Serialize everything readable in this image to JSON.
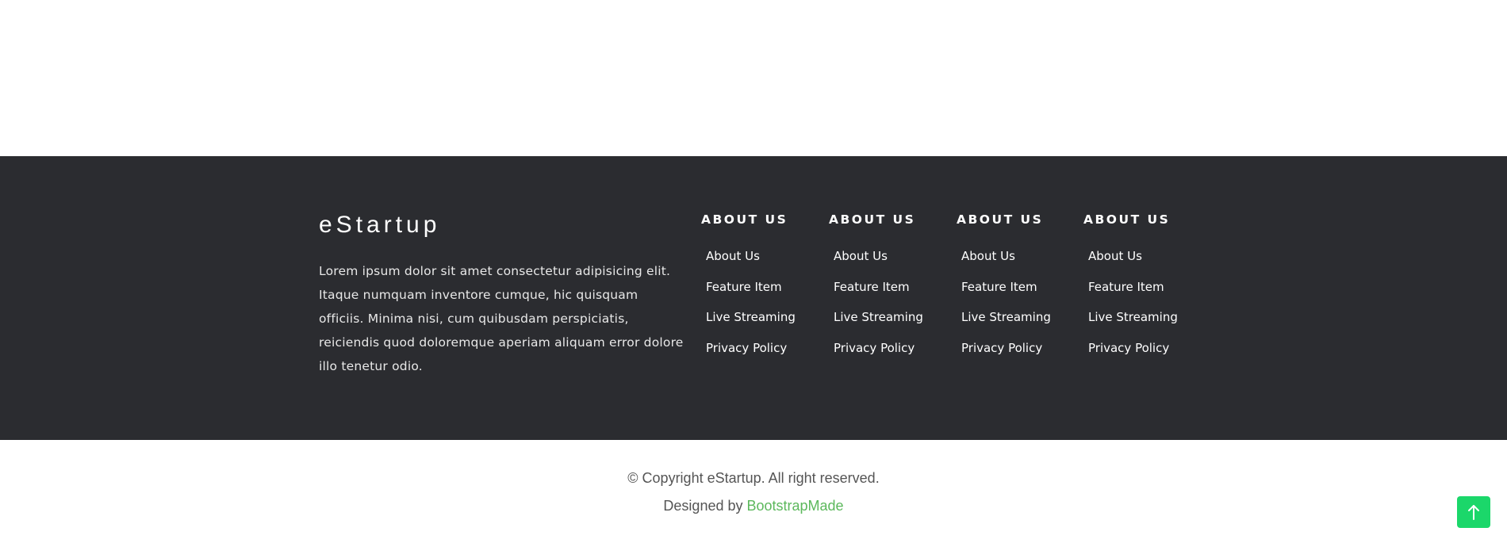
{
  "footer": {
    "brand": "eStartup",
    "description": "Lorem ipsum dolor sit amet consectetur adipisicing elit. Itaque numquam inventore cumque, hic quisquam officiis. Minima nisi, cum quibusdam perspiciatis, reiciendis quod doloremque aperiam aliquam error dolore illo tenetur odio.",
    "columns": [
      {
        "title": "ABOUT US",
        "links": [
          "About Us",
          "Feature Item",
          "Live Streaming",
          "Privacy Policy"
        ]
      },
      {
        "title": "ABOUT US",
        "links": [
          "About Us",
          "Feature Item",
          "Live Streaming",
          "Privacy Policy"
        ]
      },
      {
        "title": "ABOUT US",
        "links": [
          "About Us",
          "Feature Item",
          "Live Streaming",
          "Privacy Policy"
        ]
      },
      {
        "title": "ABOUT US",
        "links": [
          "About Us",
          "Feature Item",
          "Live Streaming",
          "Privacy Policy"
        ]
      }
    ]
  },
  "bottom": {
    "copyright": "© Copyright eStartup. All right reserved.",
    "designed_by_prefix": "Designed by ",
    "designed_by_link": "BootstrapMade"
  },
  "back_to_top": {
    "icon": "arrow-up-icon"
  },
  "colors": {
    "footer_bg": "#2b2c30",
    "accent_green": "#1bd76a",
    "link_green": "#5cb85c"
  }
}
